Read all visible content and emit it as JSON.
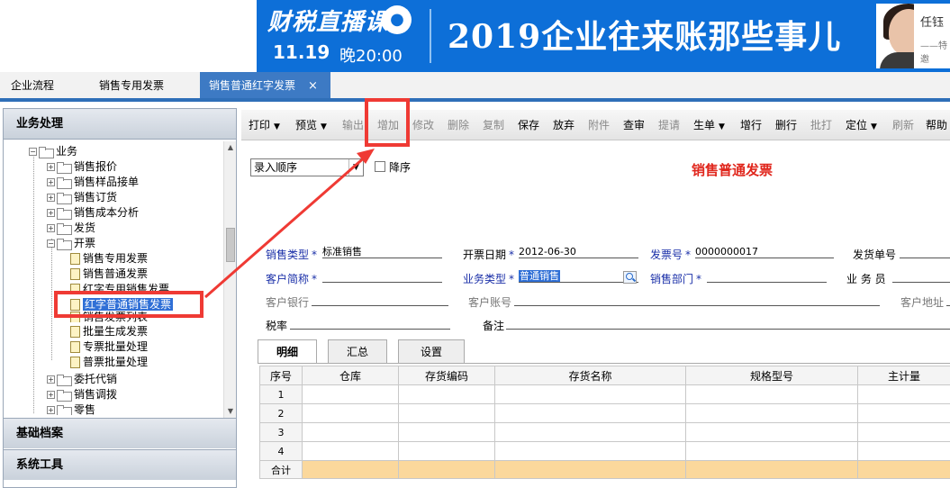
{
  "banner": {
    "logo": "财税直播课",
    "logo_icon": "●",
    "date": "11.19",
    "time": "晚20:00",
    "title": "2019企业往来账那些事儿",
    "presenter_name": "任钰",
    "presenter_note": "——特邀"
  },
  "tabs": [
    {
      "label": "企业流程"
    },
    {
      "label": "销售专用发票"
    },
    {
      "label": "销售普通红字发票",
      "close": "×"
    }
  ],
  "sidebar": {
    "header": "业务处理",
    "tree": {
      "root": "业务",
      "groups": [
        "销售报价",
        "销售样品接单",
        "销售订货",
        "销售成本分析",
        "发货"
      ],
      "open_group": "开票",
      "children": [
        "销售专用发票",
        "销售普通发票",
        "红字专用销售发票",
        "红字普通销售发票",
        "销售发票列表",
        "批量生成发票",
        "专票批量处理",
        "普票批量处理"
      ],
      "after_groups": [
        "委托代销",
        "销售调拨",
        "零售"
      ]
    },
    "footer1": "基础档案",
    "footer2": "系统工具"
  },
  "toolbar": [
    {
      "label": "打印",
      "dropdown": true,
      "enabled": true
    },
    {
      "label": "预览",
      "dropdown": true,
      "enabled": true
    },
    {
      "label": "输出",
      "enabled": false
    },
    {
      "label": "增加",
      "enabled": false
    },
    {
      "label": "修改",
      "enabled": false
    },
    {
      "label": "删除",
      "enabled": false
    },
    {
      "label": "复制",
      "enabled": false
    },
    {
      "label": "保存",
      "enabled": true
    },
    {
      "label": "放弃",
      "enabled": true
    },
    {
      "label": "附件",
      "enabled": false
    },
    {
      "label": "查审",
      "enabled": true
    },
    {
      "label": "提请",
      "enabled": false
    },
    {
      "label": "生单",
      "dropdown": true,
      "enabled": true
    },
    {
      "label": "增行",
      "enabled": true
    },
    {
      "label": "删行",
      "enabled": true
    },
    {
      "label": "批打",
      "enabled": false
    },
    {
      "label": "定位",
      "dropdown": true,
      "enabled": true
    },
    {
      "label": "刷新",
      "enabled": false
    },
    {
      "label": "帮助",
      "enabled": true
    }
  ],
  "form": {
    "order_select": "录入顺序",
    "descending_label": "降序",
    "doc_title": "销售普通发票",
    "sales_type_label": "销售类型",
    "sales_type_value": "标准销售",
    "invoice_date_label": "开票日期",
    "invoice_date_value": "2012-06-30",
    "invoice_no_label": "发票号",
    "invoice_no_value": "0000000017",
    "delivery_no_label": "发货单号",
    "customer_label": "客户简称",
    "business_type_label": "业务类型",
    "business_type_value": "普通销售",
    "sales_dept_label": "销售部门",
    "salesperson_label": "业 务 员",
    "customer_bank_label": "客户银行",
    "customer_account_label": "客户账号",
    "customer_address_label": "客户地址",
    "tax_rate_label": "税率",
    "remark_label": "备注",
    "required_mark": "*"
  },
  "detail_tabs": [
    "明细",
    "汇总",
    "设置"
  ],
  "grid": {
    "columns": [
      "序号",
      "仓库",
      "存货编码",
      "存货名称",
      "规格型号",
      "主计量"
    ],
    "rows": [
      "1",
      "2",
      "3",
      "4"
    ],
    "total_label": "合计"
  },
  "colors": {
    "banner_blue": "#0d6fd8",
    "active_tab": "#3d7ac4",
    "doc_title_red": "#e0261c",
    "label_blue": "#1a2fa8",
    "annotation_red": "#ef3a34",
    "total_row": "#fbd89c"
  }
}
